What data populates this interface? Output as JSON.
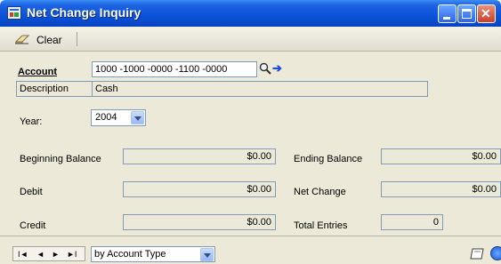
{
  "window": {
    "title": "Net Change Inquiry"
  },
  "toolbar": {
    "clear_label": "Clear"
  },
  "form": {
    "account_label": "Account",
    "account_value": "1000 -1000 -0000 -1100 -0000",
    "description_label": "Description",
    "description_value": "Cash",
    "year_label": "Year:",
    "year_value": "2004",
    "beginning_balance_label": "Beginning Balance",
    "beginning_balance_value": "$0.00",
    "ending_balance_label": "Ending Balance",
    "ending_balance_value": "$0.00",
    "debit_label": "Debit",
    "debit_value": "$0.00",
    "net_change_label": "Net Change",
    "net_change_value": "$0.00",
    "credit_label": "Credit",
    "credit_value": "$0.00",
    "total_entries_label": "Total Entries",
    "total_entries_value": "0"
  },
  "bottom": {
    "nav": {
      "first": "I◄",
      "prev": "◄",
      "next": "►",
      "last": "►I"
    },
    "sort_value": "by Account Type"
  },
  "colors": {
    "titlebar": "#0a52d8",
    "panel": "#ece9d8",
    "field_border": "#7f9db9"
  }
}
